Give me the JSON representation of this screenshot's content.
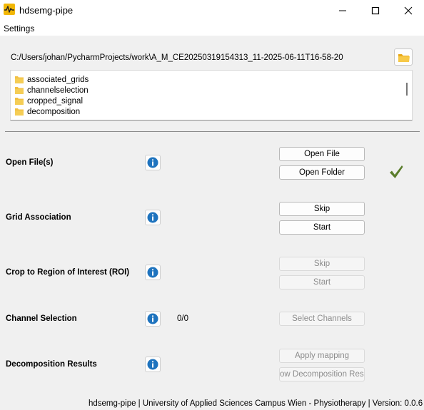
{
  "window": {
    "title": "hdsemg-pipe",
    "icon": "pulse-icon",
    "controls": [
      "minimize-icon",
      "maximize-icon",
      "close-icon"
    ]
  },
  "menu": {
    "settings_label": "Settings"
  },
  "workspace": {
    "path": "C:/Users/johan/PycharmProjects/work\\A_M_CE20250319154313_11-2025-06-11T16-58-20",
    "folder_button_icon": "folder-open-icon",
    "entries": [
      {
        "name": "associated_grids",
        "icon": "folder-icon"
      },
      {
        "name": "channelselection",
        "icon": "folder-icon"
      },
      {
        "name": "cropped_signal",
        "icon": "folder-icon"
      },
      {
        "name": "decomposition",
        "icon": "folder-icon"
      }
    ]
  },
  "steps": {
    "open_files": {
      "label": "Open File(s)",
      "open_file_label": "Open File",
      "open_folder_label": "Open Folder",
      "completed_icon": "checkmark-icon"
    },
    "grid_association": {
      "label": "Grid Association",
      "skip_label": "Skip",
      "start_label": "Start"
    },
    "crop_roi": {
      "label": "Crop to Region of Interest (ROI)",
      "skip_label": "Skip",
      "start_label": "Start"
    },
    "channel_selection": {
      "label": "Channel Selection",
      "count": "0/0",
      "select_label": "Select Channels"
    },
    "decomposition": {
      "label": "Decomposition Results",
      "apply_label": "Apply mapping",
      "show_label": "ow Decomposition Resu"
    }
  },
  "colors": {
    "info_blue": "#1e73be",
    "check_green": "#5a7d2b",
    "folder_yellow": "#f2c043"
  },
  "footer": {
    "text": "hdsemg-pipe | University of Applied Sciences Campus Wien - Physiotherapy | Version: 0.0.6"
  }
}
